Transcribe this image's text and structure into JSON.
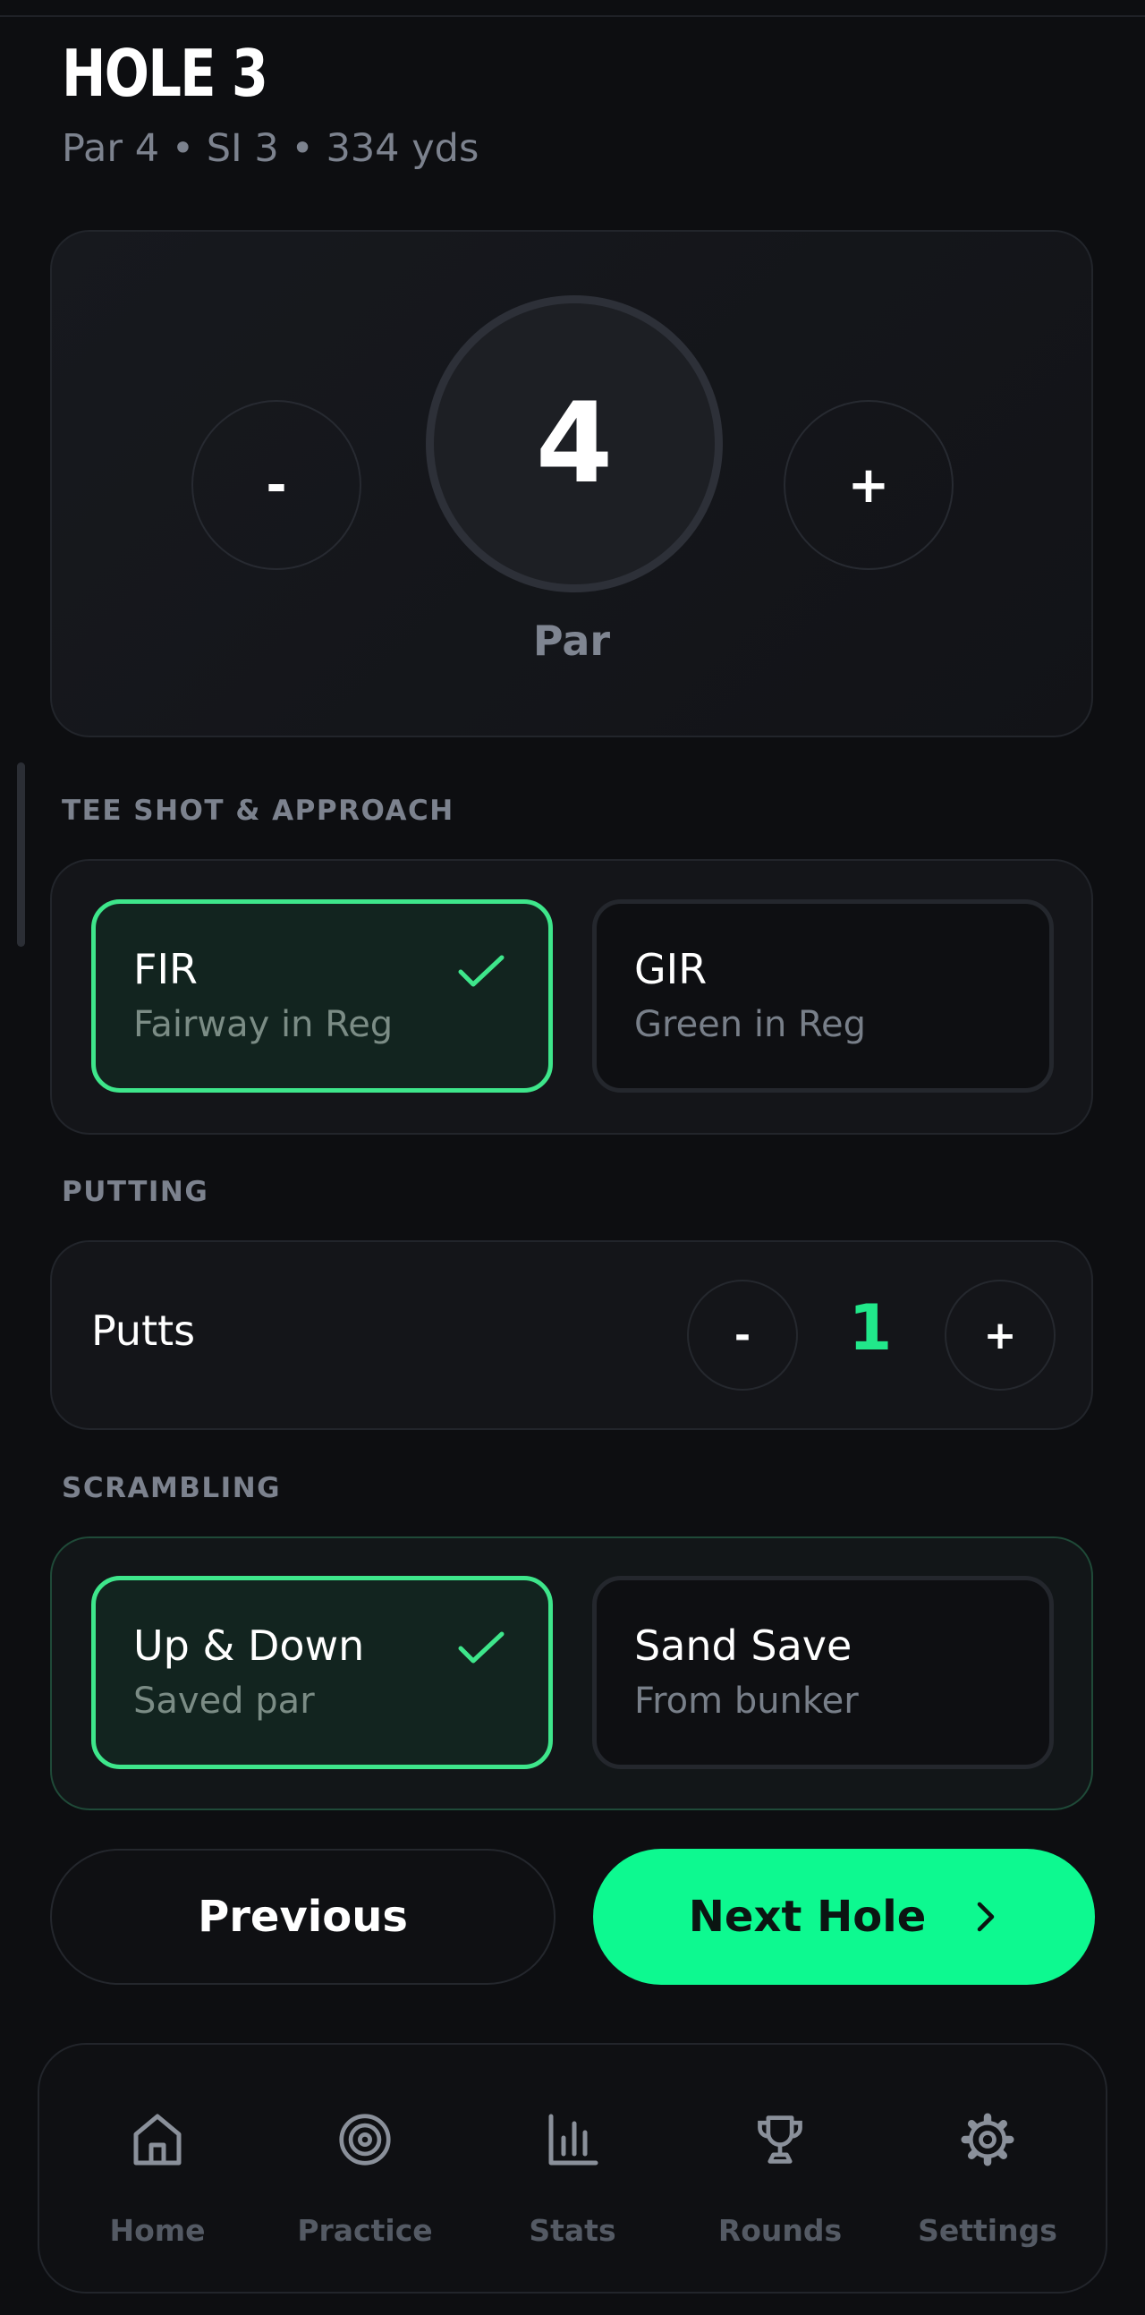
{
  "hole": {
    "title": "HOLE 3",
    "subtitle": "Par 4 • SI 3 • 334 yds"
  },
  "score": {
    "value": "4",
    "label": "Par",
    "minus": "-",
    "plus": "+"
  },
  "tee_section": {
    "label": "TEE SHOT & APPROACH",
    "fir": {
      "title": "FIR",
      "subtitle": "Fairway in Reg",
      "checked": true
    },
    "gir": {
      "title": "GIR",
      "subtitle": "Green in Reg",
      "checked": false
    }
  },
  "putting_section": {
    "label": "PUTTING",
    "putts_label": "Putts",
    "putts_value": "1",
    "minus": "-",
    "plus": "+"
  },
  "scrambling_section": {
    "label": "SCRAMBLING",
    "up_down": {
      "title": "Up & Down",
      "subtitle": "Saved par",
      "checked": true
    },
    "sand_save": {
      "title": "Sand Save",
      "subtitle": "From bunker",
      "checked": false
    }
  },
  "nav_buttons": {
    "previous": "Previous",
    "next": "Next Hole"
  },
  "tabs": [
    {
      "label": "Home",
      "icon": "home-icon"
    },
    {
      "label": "Practice",
      "icon": "target-icon"
    },
    {
      "label": "Stats",
      "icon": "bar-chart-icon"
    },
    {
      "label": "Rounds",
      "icon": "trophy-icon"
    },
    {
      "label": "Settings",
      "icon": "gear-icon"
    }
  ],
  "colors": {
    "accent": "#0df990",
    "background": "#0d0e11",
    "selected_border": "#3ee68b"
  }
}
